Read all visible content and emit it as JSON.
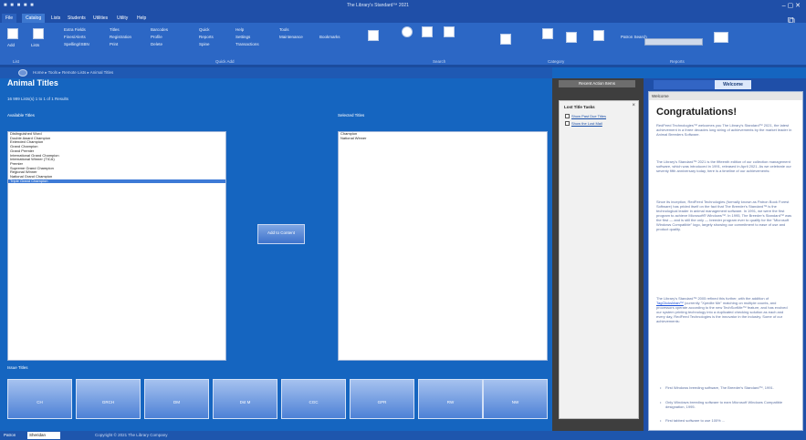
{
  "titlebar": {
    "title": "The Library's Standard™ 2021",
    "qat": "■ ■ ■ ■ ■"
  },
  "ribbon_tabs": [
    "File",
    "Catalog",
    "Lists",
    "Students",
    "Utilities",
    "Utility",
    "Help"
  ],
  "ribbon": {
    "items": [
      "Add",
      "Lists",
      "Extra Fields",
      "Fines/Alerts",
      "Spelling/ISBN",
      "Titles",
      "Registration",
      "Profile",
      "Print",
      "Barcodes",
      "Delete",
      "Quick",
      "Reports",
      "Spine",
      "Help",
      "Settings",
      "Duplicate",
      "Transactions",
      "Tools",
      "Maintenance",
      "Tools",
      "Bookmarks"
    ],
    "groups": [
      "List",
      "Quick Add",
      "Search",
      "Reference Tools",
      "Welcome",
      "Category",
      "Reports",
      "Patron Search"
    ],
    "patron_search_label": "Patron Search"
  },
  "breadcrumb": "Home  ▸  Tools  ▸  Remote Lists  ▸  Animal Titles",
  "page": {
    "heading": "Animal Titles",
    "subheading": "16 999 Lists(s) 1 to 1 of 1 Results",
    "available_label": "Available Titles",
    "selected_label": "Selected Titles",
    "add_button": "Add to Content",
    "issue_label": "Issue Titles"
  },
  "available_titles": [
    "Distinguished Word",
    "Double Award Champion",
    "Extended Champion",
    "Grand Champion",
    "Grand Premier",
    "International Grand Champion",
    "International Winner (TICA)",
    "Premier",
    "Supreme Grand Champion",
    "Regional Winner",
    "National Grand Champion",
    "Triple Grand Champion"
  ],
  "selected_titles": [
    "Champion",
    "National Winner"
  ],
  "issue_buttons": [
    "CH",
    "GRCH",
    "DM",
    "Dst M",
    "CGC",
    "GPR",
    "RW",
    "NW"
  ],
  "status": {
    "label": "Patron",
    "value": "Sheridan",
    "copyright": "Copyright © 2021 The Library Company"
  },
  "mid_panel": {
    "header": "Recent Action Items",
    "lost_title": "Lost Title Tasks",
    "lost_items": [
      "Show Past Due Titles",
      "Show the Lost Mail"
    ]
  },
  "right_panel": {
    "tab": "Welcome",
    "welcome_header": "Welcome",
    "title": "Congratulations!",
    "p1": "RedFeed Technologies™ welcomes you The Library's Standard™ 2021, the latest achievement in a three decades long string of achievements by the market leader in Animal Breeders Software.",
    "p2": "The Library's Standard™ 2021 is the fifteenth edition of our collection management software, which was introduced in 1991, released in April 2021. As we celebrate our seventy fifth anniversary today, here is a timeline of our achievements:",
    "p3": "Since its inception, RedFeed Technologies (formally known as Patron Book Forest Software) has prided itself on the fact that The Breeder's Standard™ is the technological leader in animal management software. In 1991, we were the first program to achieve Microsoft® Windows™. In 1995, The Breeder's Standard™ was the first — and is still the only — breeder program ever to qualify for the \"Microsoft Windows Compatible\" logo, largely showing our commitment to ease of use and product quality.",
    "p4a": "The Library's Standard™ 2005 refined this further, with the addition of ",
    "p4link": "TagClicksMain™",
    "p4b": " (currently \"Xpedite Me\" matching on multiple counts, and processors operate according to the new TechSortMe™ feature, and has evolved our system printing technology into a duplicated checking solution as each and every day, RedFeed Technologies is the innovator in the industry. Some of our achievements:",
    "bullets": [
      "First Windows breeding software, The Breeder's Standard™, 1991.",
      "Only Windows breeding software to earn Microsoft Windows Compatible designation, 1995.",
      "First tabbed software to use 100% ..."
    ]
  },
  "colors": {
    "accent": "#1565c0",
    "ribbon": "#2c67c5",
    "panel": "#3e3e3e"
  }
}
